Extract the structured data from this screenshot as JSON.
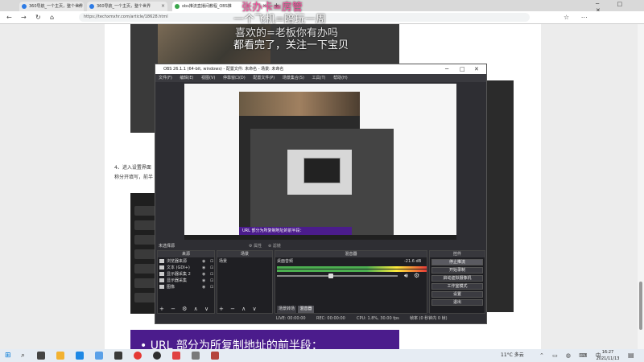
{
  "browser": {
    "tabs": [
      {
        "label": "360导航_一个主页，整个世界"
      },
      {
        "label": "360导航_一个主页，整个世界"
      },
      {
        "label": "obs推流直播间教程_OBS推"
      }
    ],
    "url": "https://techxmxhr.com/article/18628.html"
  },
  "article": {
    "step_text": "4、进入设置界面",
    "step_text2": "称分开填写，前半",
    "purple_text": "• URL 部分为所复制地址的前半段：",
    "overlay_lines": [
      "张办卡=房管",
      "一个飞机=陪玩一周",
      "喜欢的=老板你有办吗",
      "都看完了，关注一下宝贝"
    ]
  },
  "obs": {
    "title": "OBS 26.1.1 (64-bit, windows) - 配置文件: 未命名 - 场景: 未命名",
    "menu": [
      "文件(F)",
      "编辑(E)",
      "视图(V)",
      "停靠窗口(D)",
      "配置文件(P)",
      "场景集合(S)",
      "工具(T)",
      "帮助(H)"
    ],
    "scene_header": "未选择源",
    "preview_caption": "URL 部分为所复制地址的前半段：",
    "panels": {
      "scenes": "来源",
      "sources": "场景",
      "mixer": "混音器",
      "controls": "控件"
    },
    "sources": [
      {
        "name": "浏览器来源"
      },
      {
        "name": "文本 (GDI+)"
      },
      {
        "name": "显示器采集 2"
      },
      {
        "name": "显示器采集"
      },
      {
        "name": "图像"
      }
    ],
    "scene_item": "场景",
    "mixer_source": "桌面音频",
    "mixer_level": "-21.6 dB",
    "mixer_tabs": [
      "场景转场",
      "混音器"
    ],
    "controls": [
      "停止推流",
      "开始录制",
      "启动虚拟摄像机",
      "工作室模式",
      "设置",
      "退出"
    ],
    "status": [
      "LIVE: 00:00:00",
      "REC: 00:00:00",
      "CPU: 1.8%, 30.00 fps",
      "帧率 (0 秒钟内 0 帧)"
    ]
  },
  "taskbar": {
    "weather": "11°C 多云",
    "time": "16:27",
    "date": "2021/11/13"
  },
  "colors": {
    "accent_purple": "#4b1c8c",
    "obs_bg": "#2e2e33"
  }
}
